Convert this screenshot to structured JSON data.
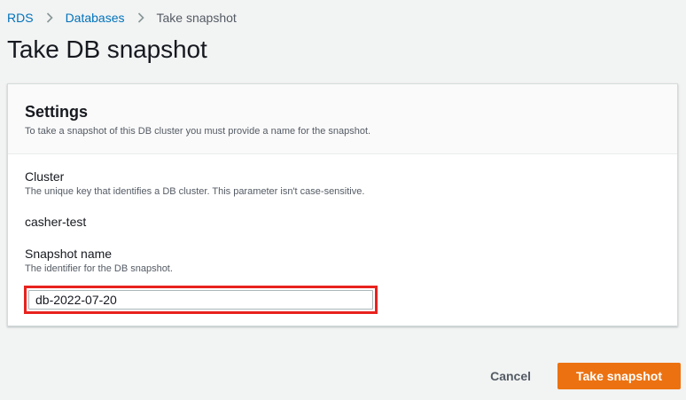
{
  "breadcrumb": {
    "items": [
      {
        "label": "RDS"
      },
      {
        "label": "Databases"
      },
      {
        "label": "Take snapshot"
      }
    ]
  },
  "page": {
    "title": "Take DB snapshot"
  },
  "settings": {
    "title": "Settings",
    "description": "To take a snapshot of this DB cluster you must provide a name for the snapshot.",
    "cluster": {
      "label": "Cluster",
      "description": "The unique key that identifies a DB cluster. This parameter isn't case-sensitive.",
      "value": "casher-test"
    },
    "snapshot_name": {
      "label": "Snapshot name",
      "description": "The identifier for the DB snapshot.",
      "value": "db-2022-07-20"
    }
  },
  "actions": {
    "cancel_label": "Cancel",
    "submit_label": "Take snapshot"
  },
  "colors": {
    "link": "#0073bb",
    "primary": "#ec7211",
    "highlight": "#e8221e",
    "background": "#f2f3f3"
  },
  "icons": {
    "separator": "chevron-right-icon"
  }
}
